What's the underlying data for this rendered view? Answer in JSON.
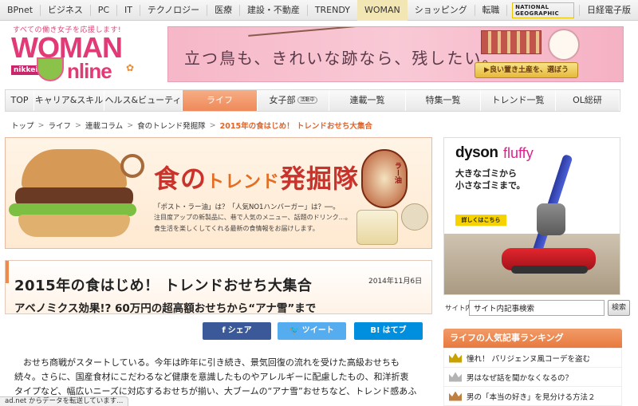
{
  "network_bar": {
    "links": [
      "BPnet",
      "ビジネス",
      "PC",
      "IT",
      "テクノロジー",
      "医療",
      "建設・不動産",
      "TRENDY",
      "WOMAN",
      "ショッピング"
    ],
    "active": "WOMAN",
    "right_links": [
      "転職",
      "NATIONAL GEOGRAPHIC",
      "日経電子版"
    ]
  },
  "logo": {
    "tagline": "すべての働き女子を応援します!",
    "woman": "WOMAN",
    "nikkei": "nikkei",
    "online": "nline"
  },
  "top_ad": {
    "copy": "立つ鳥も、きれいな跡なら、残したい。",
    "button": "▶良い置き土産を、選ぼう"
  },
  "nav": {
    "items": [
      "TOP",
      "キャリア&スキル",
      "ヘルス&ビューティ",
      "ライフ",
      "女子部",
      "連載一覧",
      "特集一覧",
      "トレンド一覧",
      "OL総研"
    ],
    "active": "ライフ",
    "badge": "活動中"
  },
  "breadcrumb": [
    "トップ",
    "ライフ",
    "連載コラム",
    "食のトレンド発掘隊"
  ],
  "breadcrumb_current": "2015年の食はじめ！ トレンドおせち大集合",
  "feature": {
    "title_a": "食の",
    "title_b": "トレンド",
    "title_c": "発掘隊",
    "desc1": "「ポスト・ラー油」は？「人気NO1ハンバーガー」は？──。",
    "desc2": "注目度アップの新製品に、巷で人気のメニュー、話題のドリンク…。",
    "desc3": "食生活を楽しくしてくれる最新の食情報をお届けします。",
    "jar_label": "ラー油"
  },
  "article": {
    "title": "2015年の食はじめ！ トレンドおせち大集合",
    "date": "2014年11月6日",
    "subtitle": "アベノミクス効果!? 60万円の超高額おせちから“アナ雪”まで",
    "share": {
      "fb": "シェア",
      "tw": "ツイート",
      "hb": "はてブ",
      "hb_icon": "B!"
    },
    "body": [
      "　おせち商戦がスタートしている。今年は昨年に引き続き、景気回復の流れを受けた高級おせちも",
      "続々。さらに、国産食材にこだわるなど健康を意識したものやアレルギーに配慮したもの、和洋折衷",
      "タイプなど、幅広いニーズに対応するおせちが揃い、大ブームの“アナ雪”おせちなど、トレンド感あふ"
    ]
  },
  "status_bar": "ad.net からデータを転送しています...",
  "side_ad": {
    "brand": "dyson",
    "model": "fluffy",
    "line1": "大きなゴミから",
    "line2": "小さなゴミまで。",
    "cta": "詳しくはこちら"
  },
  "search": {
    "label": "サイト内",
    "value": "サイト内記事検索",
    "button": "検索"
  },
  "ranking": {
    "title": "ライフの人気記事ランキング",
    "items": [
      "憧れ！ パリジェンヌ風コーデを盗む",
      "男はなぜ話を聞かなくなるの？",
      "男の「本当の好き」を見分ける方法２"
    ]
  }
}
